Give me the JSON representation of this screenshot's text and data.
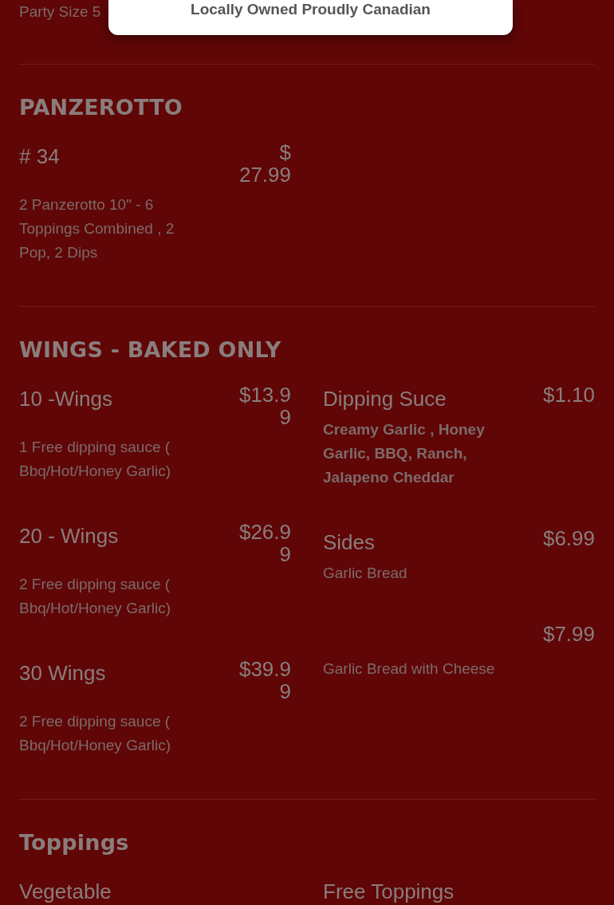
{
  "banner": {
    "text": "Locally Owned  Proudly Canadian"
  },
  "intro": {
    "text": "Party Size 5"
  },
  "sections": [
    {
      "title": "PANZEROTTO",
      "columns": [
        [
          {
            "name": "# 34",
            "price": "$ 27.99",
            "description": "2 Panzerotto 10\" - 6 Toppings Combined , 2 Pop, 2 Dips",
            "emphasis": false
          }
        ],
        []
      ]
    },
    {
      "title": "WINGS - BAKED ONLY",
      "columns": [
        [
          {
            "name": "10 -Wings",
            "price": "$13.99",
            "description": "1 Free dipping sauce ( Bbq/Hot/Honey Garlic)",
            "emphasis": false
          },
          {
            "name": "20 - Wings",
            "price": "$26.99",
            "description": "2 Free dipping sauce ( Bbq/Hot/Honey Garlic)",
            "emphasis": false
          },
          {
            "name": "30 Wings",
            "price": "$39.99",
            "description": "2 Free dipping sauce ( Bbq/Hot/Honey Garlic)",
            "emphasis": false
          }
        ],
        [
          {
            "name": "Dipping Suce",
            "price": "$1.10",
            "description": "Creamy Garlic , Honey Garlic, BBQ, Ranch, Jalapeno Cheddar",
            "emphasis": true
          },
          {
            "name": "Sides",
            "price": "$6.99",
            "description": "Garlic Bread",
            "emphasis": false
          },
          {
            "price": "$7.99",
            "description": "Garlic Bread with Cheese",
            "emphasis": false
          }
        ]
      ]
    },
    {
      "title": "Toppings",
      "columns": [
        [
          {
            "name": "Vegetable"
          }
        ],
        [
          {
            "name": "Free Toppings"
          }
        ]
      ]
    }
  ]
}
